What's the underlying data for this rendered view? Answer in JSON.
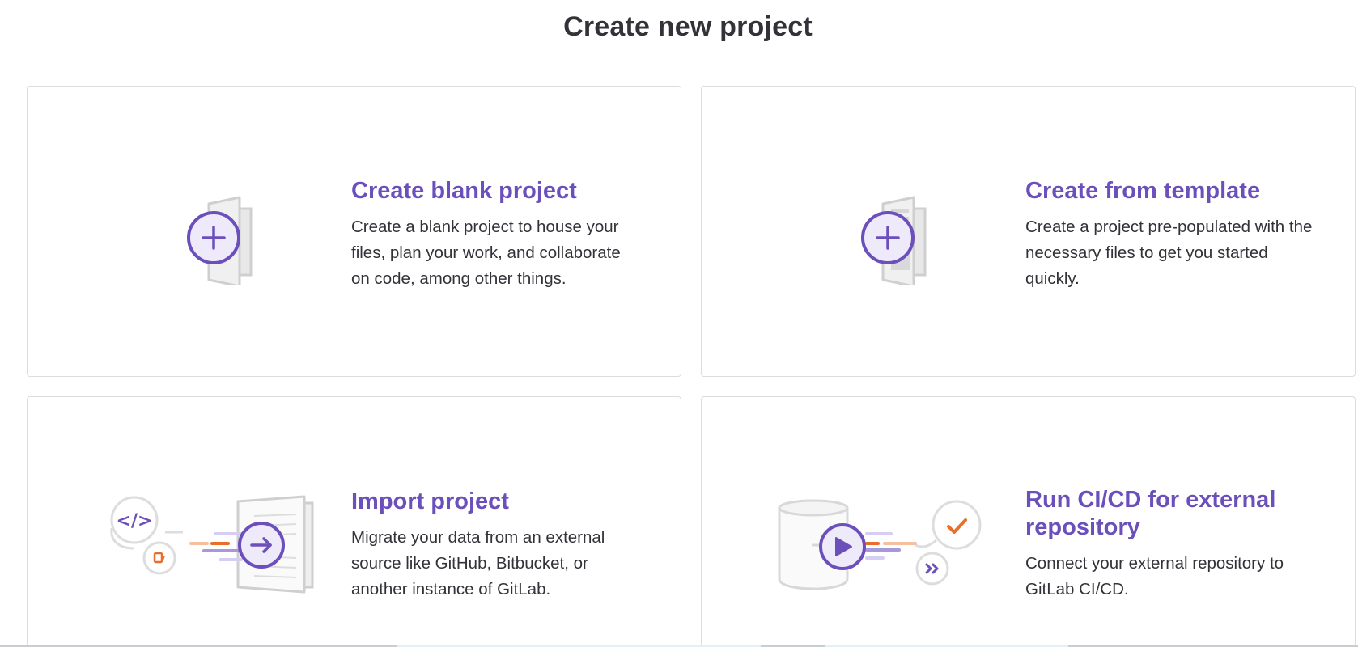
{
  "page": {
    "title": "Create new project"
  },
  "cards": [
    {
      "title": "Create blank project",
      "description": "Create a blank project to house your files, plan your work, and collaborate on code, among other things.",
      "illustration": "plus-icon"
    },
    {
      "title": "Create from template",
      "description": "Create a project pre-populated with the necessary files to get you started quickly.",
      "illustration": "template-plus-icon"
    },
    {
      "title": "Import project",
      "description": "Migrate your data from an external source like GitHub, Bitbucket, or another instance of GitLab.",
      "illustration": "import-arrow-icon"
    },
    {
      "title": "Run CI/CD for external repository",
      "description": "Connect your external repository to GitLab CI/CD.",
      "illustration": "cicd-play-icon"
    }
  ],
  "colors": {
    "accent": "#6b4fbb",
    "orange": "#e86e2a",
    "border": "#dcdcde"
  }
}
